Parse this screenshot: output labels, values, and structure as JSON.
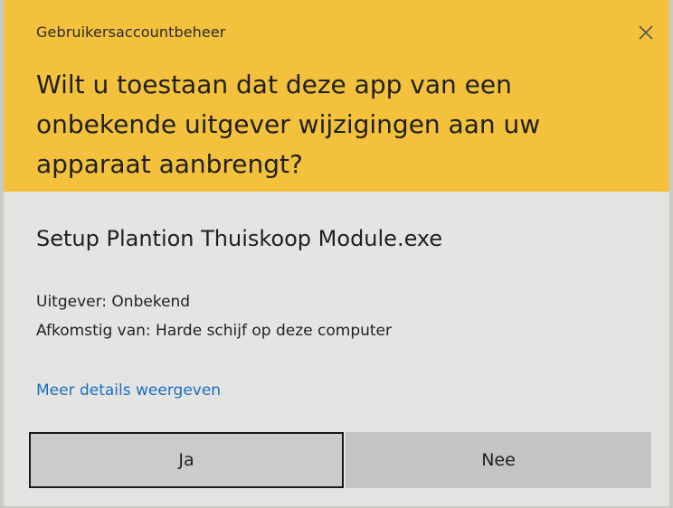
{
  "dialog": {
    "app_title": "Gebruikersaccountbeheer",
    "close_glyph": "✕",
    "question": "Wilt u toestaan dat deze app van een\nonbekende uitgever wijzigingen aan uw\napparaat aanbrengt?",
    "program_name": "Setup Plantion Thuiskoop Module.exe",
    "publisher": "Uitgever: Onbekend",
    "origin": "Afkomstig van: Harde schijf op deze computer",
    "more_details": "Meer details weergeven",
    "yes_label": "Ja",
    "no_label": "Nee"
  },
  "icons": {
    "close": "close-icon"
  },
  "colors": {
    "header_bg": "#f3c13c",
    "body_bg": "#e4e4e2",
    "link": "#1a6fc0",
    "button_bg": "#cbcbca",
    "focus_border": "#1a1a1a"
  }
}
